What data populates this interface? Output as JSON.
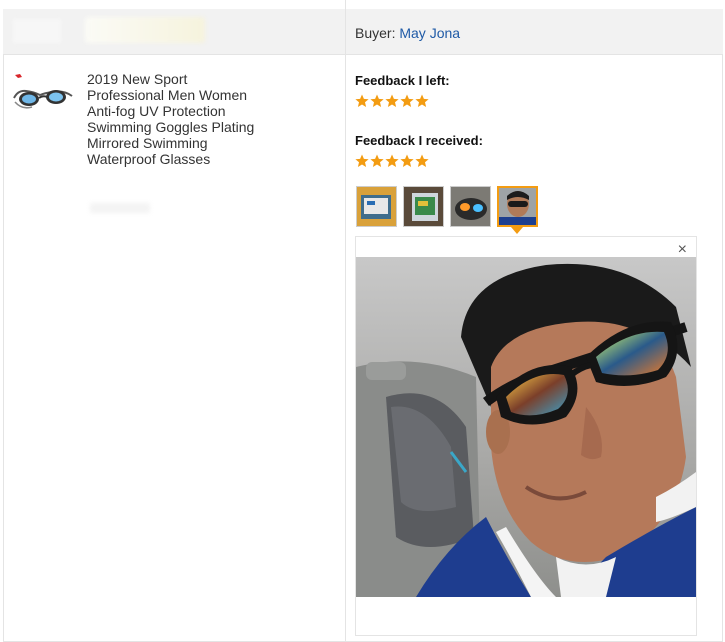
{
  "header": {
    "buyer_label": "Buyer:",
    "buyer_name": "May Jona"
  },
  "product": {
    "title": "2019 New Sport Professional Men Women Anti-fog UV Protection Swimming Goggles Plating Mirrored Swimming Waterproof Glasses",
    "image_icon": "swimming-goggles-image"
  },
  "feedback": {
    "left_label": "Feedback I left:",
    "left_rating": 5,
    "received_label": "Feedback I received:",
    "received_rating": 5,
    "star_color": "#f39c12"
  },
  "photos": {
    "thumbnails": [
      "photo-1",
      "photo-2",
      "photo-3",
      "photo-4"
    ],
    "selected_index": 3,
    "close_icon": "×"
  },
  "colors": {
    "link": "#1f5aa6",
    "accent": "#f39c12",
    "header_bg": "#f2f2f2"
  }
}
